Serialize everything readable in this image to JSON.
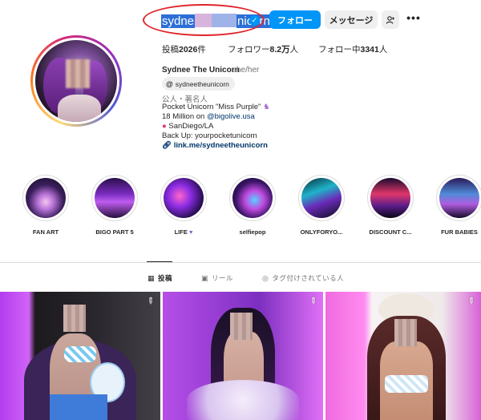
{
  "profile": {
    "username_start": "sydne",
    "username_end": "nicorn",
    "follow_label": "フォロー",
    "message_label": "メッセージ",
    "add_user_icon": "add-user-icon",
    "more_label": "•••",
    "stats": {
      "posts_label": "投稿",
      "posts_value": "2026",
      "posts_unit": "件",
      "followers_label": "フォロワー",
      "followers_value": "8.2万",
      "followers_unit": "人",
      "following_label": "フォロー中",
      "following_value": "3341",
      "following_unit": "人"
    },
    "full_name": "Sydnee The Unicorn",
    "pronouns": "she/her",
    "threads_handle": "sydneetheunicorn",
    "category": "公人・著名人",
    "bio_line1": "Pocket Unicorn \"Miss Purple\"",
    "bio_line2_prefix": "18 Million on ",
    "bio_line2_mention": "@bigolive.usa",
    "bio_line3": "SanDiego/LA",
    "bio_line4": "Back Up: yourpocketunicorn",
    "link": "link.me/sydneetheunicorn"
  },
  "highlights": [
    {
      "label": "FAN ART"
    },
    {
      "label": "BIGO PART 5"
    },
    {
      "label": "LIFE"
    },
    {
      "label": "selfiepop"
    },
    {
      "label": "ONLYFORYO..."
    },
    {
      "label": "DISCOUNT C..."
    },
    {
      "label": "FUR BABIES"
    }
  ],
  "tabs": {
    "posts": "投稿",
    "reels": "リール",
    "tagged": "タグ付けされている人"
  },
  "colors": {
    "accent": "#0095f6",
    "annotation": "#e0242b",
    "link": "#00376b"
  }
}
